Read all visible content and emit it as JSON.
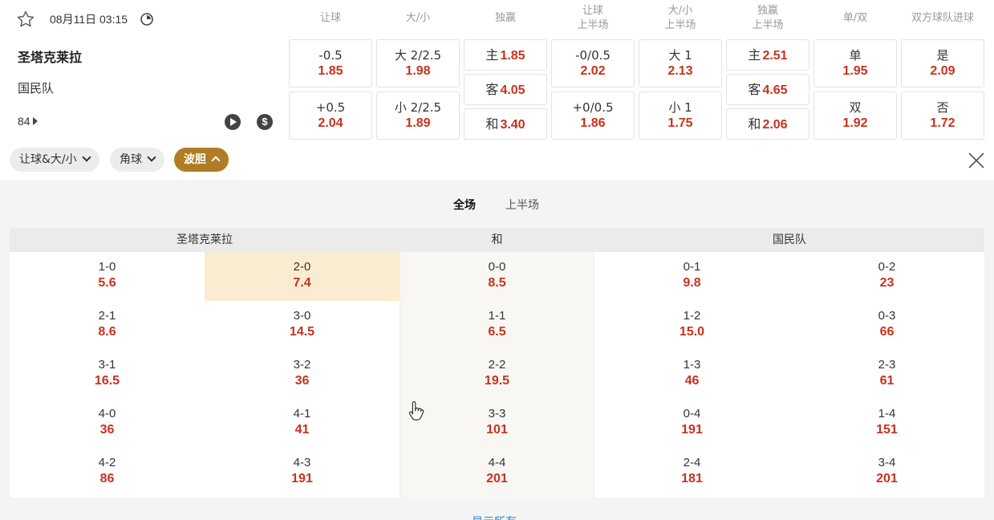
{
  "match": {
    "date_time": "08月11日 03:15",
    "home_team": "圣塔克莱拉",
    "away_team": "国民队",
    "minute": "84"
  },
  "columns": [
    "让球",
    "大/小",
    "独赢",
    "让球\n上半场",
    "大/小\n上半场",
    "独赢\n上半场",
    "单/双",
    "双方球队进球"
  ],
  "odds": {
    "handicap": [
      {
        "label": "-0.5",
        "value": "1.85"
      },
      {
        "label": "+0.5",
        "value": "2.04"
      }
    ],
    "over_under": [
      {
        "label": "大 2/2.5",
        "value": "1.98"
      },
      {
        "label": "小 2/2.5",
        "value": "1.89"
      }
    ],
    "moneyline": [
      {
        "label": "主",
        "value": "1.85"
      },
      {
        "label": "客",
        "value": "4.05"
      },
      {
        "label": "和",
        "value": "3.40"
      }
    ],
    "handicap_1h": [
      {
        "label": "-0/0.5",
        "value": "2.02"
      },
      {
        "label": "+0/0.5",
        "value": "1.86"
      }
    ],
    "over_under_1h": [
      {
        "label": "大 1",
        "value": "2.13"
      },
      {
        "label": "小 1",
        "value": "1.75"
      }
    ],
    "moneyline_1h": [
      {
        "label": "主",
        "value": "2.51"
      },
      {
        "label": "客",
        "value": "4.65"
      },
      {
        "label": "和",
        "value": "2.06"
      }
    ],
    "odd_even": [
      {
        "label": "单",
        "value": "1.95"
      },
      {
        "label": "双",
        "value": "1.92"
      }
    ],
    "btts": [
      {
        "label": "是",
        "value": "2.09"
      },
      {
        "label": "否",
        "value": "1.72"
      }
    ]
  },
  "chips": [
    "让球&大/小",
    "角球",
    "波胆"
  ],
  "subtabs": [
    "全场",
    "上半场"
  ],
  "correct_score": {
    "headers": [
      "圣塔克莱拉",
      "和",
      "国民队"
    ],
    "columns": [
      [
        {
          "s": "1-0",
          "p": "5.6"
        },
        {
          "s": "2-1",
          "p": "8.6"
        },
        {
          "s": "3-1",
          "p": "16.5"
        },
        {
          "s": "4-0",
          "p": "36"
        },
        {
          "s": "4-2",
          "p": "86"
        }
      ],
      [
        {
          "s": "2-0",
          "p": "7.4"
        },
        {
          "s": "3-0",
          "p": "14.5"
        },
        {
          "s": "3-2",
          "p": "36"
        },
        {
          "s": "4-1",
          "p": "41"
        },
        {
          "s": "4-3",
          "p": "191"
        }
      ],
      [
        {
          "s": "0-0",
          "p": "8.5"
        },
        {
          "s": "1-1",
          "p": "6.5"
        },
        {
          "s": "2-2",
          "p": "19.5"
        },
        {
          "s": "3-3",
          "p": "101"
        },
        {
          "s": "4-4",
          "p": "201"
        }
      ],
      [
        {
          "s": "0-1",
          "p": "9.8"
        },
        {
          "s": "1-2",
          "p": "15.0"
        },
        {
          "s": "1-3",
          "p": "46"
        },
        {
          "s": "0-4",
          "p": "191"
        },
        {
          "s": "2-4",
          "p": "181"
        }
      ],
      [
        {
          "s": "0-2",
          "p": "23"
        },
        {
          "s": "0-3",
          "p": "66"
        },
        {
          "s": "2-3",
          "p": "61"
        },
        {
          "s": "1-4",
          "p": "151"
        },
        {
          "s": "3-4",
          "p": "201"
        }
      ]
    ]
  },
  "show_all_label": "显示所有",
  "colors": {
    "accent": "#b07d26",
    "odds_red": "#c8321e",
    "selected_cell": "#faecd0"
  }
}
